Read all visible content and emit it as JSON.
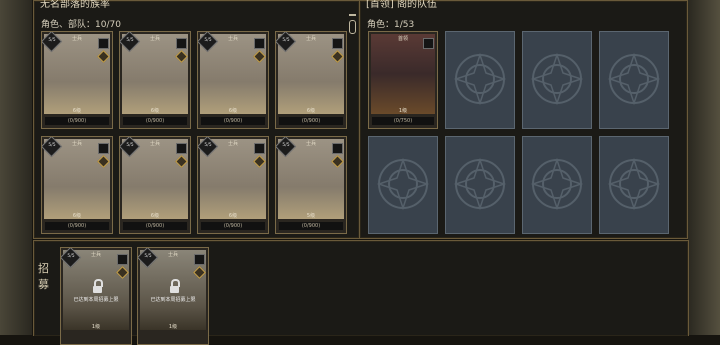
{
  "left_panel": {
    "title": "无名部落的族率",
    "label": "角色、部队：10/70",
    "cards": [
      {
        "badge": "5/5",
        "name": "士兵",
        "level": "6级",
        "exp": "(0/900)"
      },
      {
        "badge": "5/5",
        "name": "士兵",
        "level": "6级",
        "exp": "(0/900)"
      },
      {
        "badge": "5/5",
        "name": "士兵",
        "level": "6级",
        "exp": "(0/900)"
      },
      {
        "badge": "5/5",
        "name": "士兵",
        "level": "6级",
        "exp": "(0/900)"
      },
      {
        "badge": "5/5",
        "name": "士兵",
        "level": "6级",
        "exp": "(0/900)"
      },
      {
        "badge": "5/5",
        "name": "士兵",
        "level": "6级",
        "exp": "(0/900)"
      },
      {
        "badge": "5/5",
        "name": "士兵",
        "level": "6级",
        "exp": "(0/900)"
      },
      {
        "badge": "5/5",
        "name": "士兵",
        "level": "5级",
        "exp": "(0/900)"
      }
    ]
  },
  "right_panel": {
    "title": "[首领] 阁的队伍",
    "label": "角色：1/53",
    "card": {
      "name": "首领",
      "level": "1级",
      "exp": "(0/750)"
    }
  },
  "bottom_panel": {
    "recruit_label": "招募",
    "cards": [
      {
        "badge": "5/5",
        "name": "士兵",
        "lock_text": "已达到本周招募上限",
        "level": "1级"
      },
      {
        "badge": "5/5",
        "name": "士兵",
        "lock_text": "已达到本周招募上限",
        "level": "1级"
      }
    ]
  }
}
